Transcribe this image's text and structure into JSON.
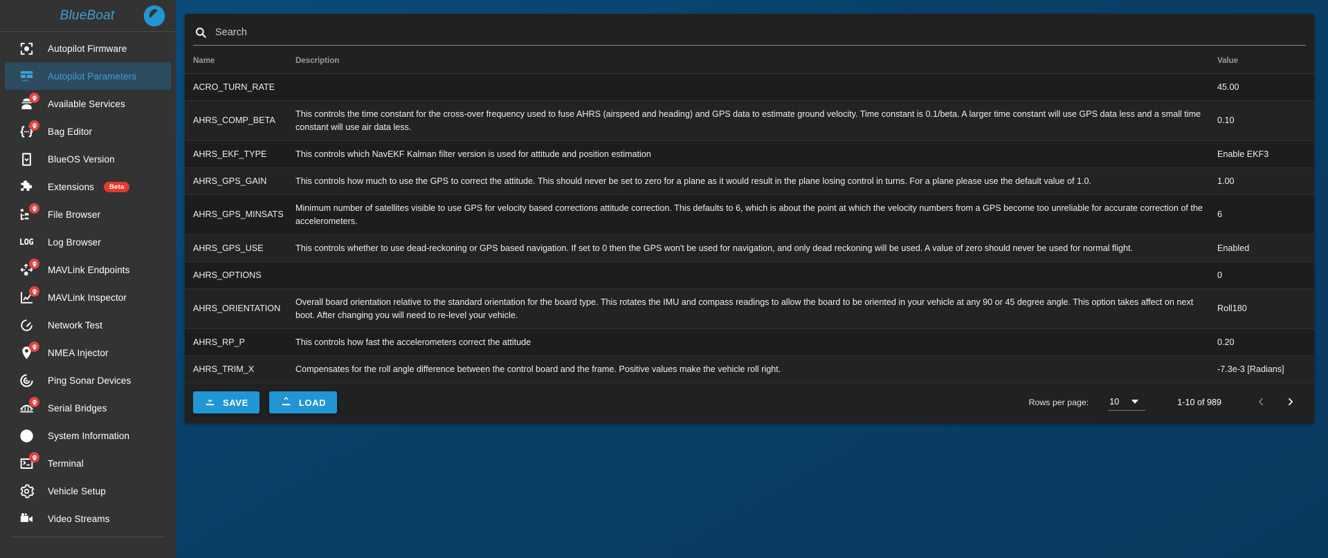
{
  "sidebar": {
    "brand": "BlueBoat",
    "logo_icon": "blueos-logo-icon",
    "items": [
      {
        "label": "Autopilot Firmware",
        "icon": "autopilot-firmware-icon",
        "active": false,
        "alert": false,
        "badge": null
      },
      {
        "label": "Autopilot Parameters",
        "icon": "table-grid-icon",
        "active": true,
        "alert": false,
        "badge": null
      },
      {
        "label": "Available Services",
        "icon": "services-person-icon",
        "active": false,
        "alert": true,
        "badge": null
      },
      {
        "label": "Bag Editor",
        "icon": "braces-icon",
        "active": false,
        "alert": true,
        "badge": null
      },
      {
        "label": "BlueOS Version",
        "icon": "device-download-icon",
        "active": false,
        "alert": false,
        "badge": null
      },
      {
        "label": "Extensions",
        "icon": "puzzle-piece-icon",
        "active": false,
        "alert": false,
        "badge": "Beta"
      },
      {
        "label": "File Browser",
        "icon": "file-tree-icon",
        "active": false,
        "alert": true,
        "badge": null
      },
      {
        "label": "Log Browser",
        "icon": "log-text-icon",
        "active": false,
        "alert": false,
        "badge": null
      },
      {
        "label": "MAVLink Endpoints",
        "icon": "endpoints-arrows-icon",
        "active": false,
        "alert": true,
        "badge": null
      },
      {
        "label": "MAVLink Inspector",
        "icon": "chart-line-icon",
        "active": false,
        "alert": true,
        "badge": null
      },
      {
        "label": "Network Test",
        "icon": "speedometer-icon",
        "active": false,
        "alert": false,
        "badge": null
      },
      {
        "label": "NMEA Injector",
        "icon": "map-pin-icon",
        "active": false,
        "alert": true,
        "badge": null
      },
      {
        "label": "Ping Sonar Devices",
        "icon": "sonar-waves-icon",
        "active": false,
        "alert": false,
        "badge": null
      },
      {
        "label": "Serial Bridges",
        "icon": "bridge-icon",
        "active": false,
        "alert": true,
        "badge": null
      },
      {
        "label": "System Information",
        "icon": "pie-half-icon",
        "active": false,
        "alert": false,
        "badge": null
      },
      {
        "label": "Terminal",
        "icon": "terminal-prompt-icon",
        "active": false,
        "alert": true,
        "badge": null
      },
      {
        "label": "Vehicle Setup",
        "icon": "gear-icon",
        "active": false,
        "alert": false,
        "badge": null
      },
      {
        "label": "Video Streams",
        "icon": "video-camera-icon",
        "active": false,
        "alert": false,
        "badge": null
      }
    ]
  },
  "search": {
    "placeholder": "Search",
    "value": "",
    "icon": "search-icon"
  },
  "table": {
    "columns": {
      "name": "Name",
      "description": "Description",
      "value": "Value"
    },
    "rows": [
      {
        "name": "ACRO_TURN_RATE",
        "description": "",
        "value": "45.00"
      },
      {
        "name": "AHRS_COMP_BETA",
        "description": "This controls the time constant for the cross-over frequency used to fuse AHRS (airspeed and heading) and GPS data to estimate ground velocity. Time constant is 0.1/beta. A larger time constant will use GPS data less and a small time constant will use air data less.",
        "value": "0.10"
      },
      {
        "name": "AHRS_EKF_TYPE",
        "description": "This controls which NavEKF Kalman filter version is used for attitude and position estimation",
        "value": "Enable EKF3"
      },
      {
        "name": "AHRS_GPS_GAIN",
        "description": "This controls how much to use the GPS to correct the attitude. This should never be set to zero for a plane as it would result in the plane losing control in turns. For a plane please use the default value of 1.0.",
        "value": "1.00"
      },
      {
        "name": "AHRS_GPS_MINSATS",
        "description": "Minimum number of satellites visible to use GPS for velocity based corrections attitude correction. This defaults to 6, which is about the point at which the velocity numbers from a GPS become too unreliable for accurate correction of the accelerometers.",
        "value": "6"
      },
      {
        "name": "AHRS_GPS_USE",
        "description": "This controls whether to use dead-reckoning or GPS based navigation. If set to 0 then the GPS won't be used for navigation, and only dead reckoning will be used. A value of zero should never be used for normal flight.",
        "value": "Enabled"
      },
      {
        "name": "AHRS_OPTIONS",
        "description": "",
        "value": "0"
      },
      {
        "name": "AHRS_ORIENTATION",
        "description": "Overall board orientation relative to the standard orientation for the board type. This rotates the IMU and compass readings to allow the board to be oriented in your vehicle at any 90 or 45 degree angle. This option takes affect on next boot. After changing you will need to re-level your vehicle.",
        "value": "Roll180"
      },
      {
        "name": "AHRS_RP_P",
        "description": "This controls how fast the accelerometers correct the attitude",
        "value": "0.20"
      },
      {
        "name": "AHRS_TRIM_X",
        "description": "Compensates for the roll angle difference between the control board and the frame. Positive values make the vehicle roll right.",
        "value": "-7.3e-3 [Radians]"
      }
    ]
  },
  "footer": {
    "save_label": "SAVE",
    "save_icon": "download-icon",
    "load_label": "LOAD",
    "load_icon": "upload-icon",
    "rows_per_page_label": "Rows per page:",
    "rows_per_page_value": "10",
    "range_label": "1-10 of 989",
    "prev_icon": "chevron-left-icon",
    "next_icon": "chevron-right-icon"
  },
  "colors": {
    "accent": "#2196d3",
    "brand_text": "#3f9fd6",
    "sidebar_bg": "#333333",
    "card_bg": "#212121",
    "alert_badge": "#e04545",
    "beta_badge": "#e8392e",
    "page_bg": "#0d4d7c"
  }
}
